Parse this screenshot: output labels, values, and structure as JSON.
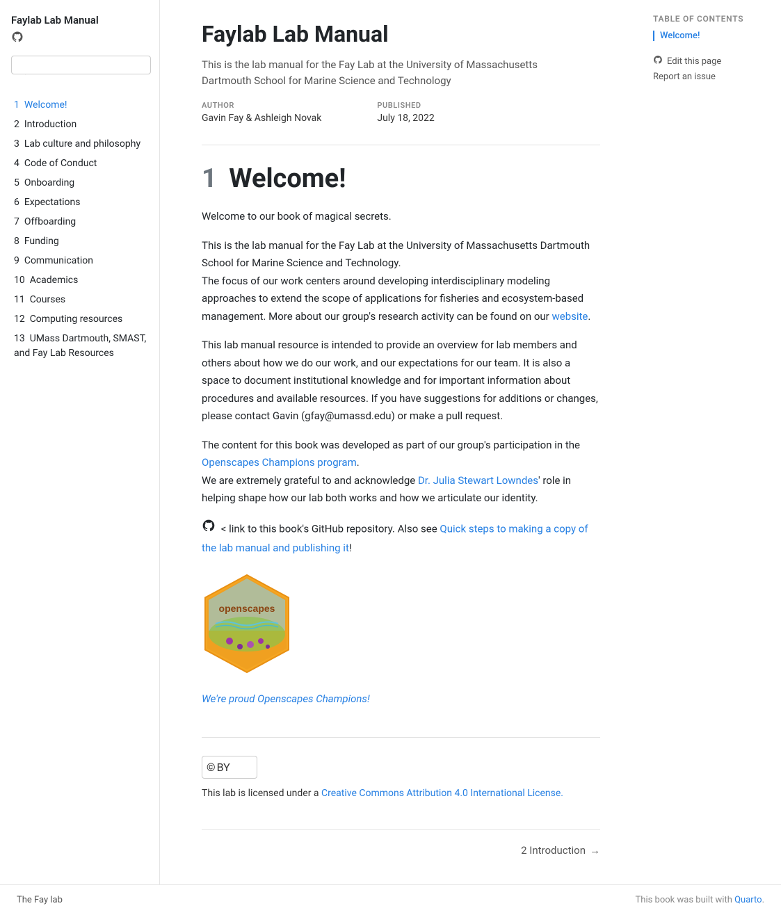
{
  "site": {
    "title": "Faylab Lab Manual",
    "github_icon": "⊙"
  },
  "search": {
    "placeholder": "🔍"
  },
  "nav": {
    "items": [
      {
        "number": "1",
        "label": "Welcome!",
        "active": true,
        "href": "#"
      },
      {
        "number": "2",
        "label": "Introduction",
        "href": "#"
      },
      {
        "number": "3",
        "label": "Lab culture and philosophy",
        "href": "#"
      },
      {
        "number": "4",
        "label": "Code of Conduct",
        "href": "#"
      },
      {
        "number": "5",
        "label": "Onboarding",
        "href": "#"
      },
      {
        "number": "6",
        "label": "Expectations",
        "href": "#"
      },
      {
        "number": "7",
        "label": "Offboarding",
        "href": "#"
      },
      {
        "number": "8",
        "label": "Funding",
        "href": "#"
      },
      {
        "number": "9",
        "label": "Communication",
        "href": "#"
      },
      {
        "number": "10",
        "label": "Academics",
        "href": "#"
      },
      {
        "number": "11",
        "label": "Courses",
        "href": "#"
      },
      {
        "number": "12",
        "label": "Computing resources",
        "href": "#"
      },
      {
        "number": "13",
        "label": "UMass Dartmouth, SMAST, and Fay Lab Resources",
        "href": "#"
      }
    ]
  },
  "header": {
    "title": "Faylab Lab Manual",
    "subtitle_line1": "This is the lab manual for the Fay Lab at the University of Massachusetts",
    "subtitle_line2": "Dartmouth School for Marine Science and Technology",
    "author_label": "AUTHOR",
    "author_value": "Gavin Fay & Ashleigh Novak",
    "published_label": "PUBLISHED",
    "published_value": "July 18, 2022"
  },
  "content": {
    "welcome_number": "1",
    "welcome_title": "Welcome!",
    "para1": "Welcome to our book of magical secrets.",
    "para2a": "This is the lab manual for the Fay Lab at the University of Massachusetts Dartmouth School for Marine Science and Technology.",
    "para2b": "The focus of our work centers around developing interdisciplinary modeling approaches to extend the scope of applications for fisheries and ecosystem-based management. More about our group's research activity can be found on our ",
    "website_link_text": "website",
    "para2b_end": ".",
    "para3a": "This lab manual resource is intended to provide an overview for lab members and others about how we do our work, and our expectations for our team. It is also a space to document institutional knowledge and for important information about procedures and available resources. If you have suggestions for additions or changes, please contact Gavin (gfay@umassd.edu) or make a pull request.",
    "para4a": "The content for this book was developed as part of our group's participation in the ",
    "openscapes_link": "Openscapes Champions program",
    "para4a_end": ".",
    "para4b": "We are extremely grateful to and acknowledge ",
    "julia_link": "Dr. Julia Stewart Lowndes",
    "para4b_end": "' role in helping shape how our lab both works and how we articulate our identity.",
    "github_text": "< link to this book's GitHub repository. Also see ",
    "quick_steps_link": "Quick steps to making a copy of the lab manual and publishing it",
    "quick_steps_end": "!",
    "proud_link_text": "We're proud Openscapes Champions!",
    "cc_text_before": "This lab is licensed under a ",
    "cc_link_text": "Creative Commons Attribution 4.0 International License.",
    "next_label": "2  Introduction"
  },
  "toc": {
    "title": "Table of contents",
    "items": [
      {
        "label": "Welcome!",
        "href": "#",
        "active": true
      }
    ],
    "actions": [
      {
        "icon": "github",
        "label": "Edit this page"
      },
      {
        "label": "Report an issue"
      }
    ]
  },
  "footer": {
    "left_link": "The Fay lab",
    "right_text": "This book was built with ",
    "right_link": "Quarto"
  }
}
